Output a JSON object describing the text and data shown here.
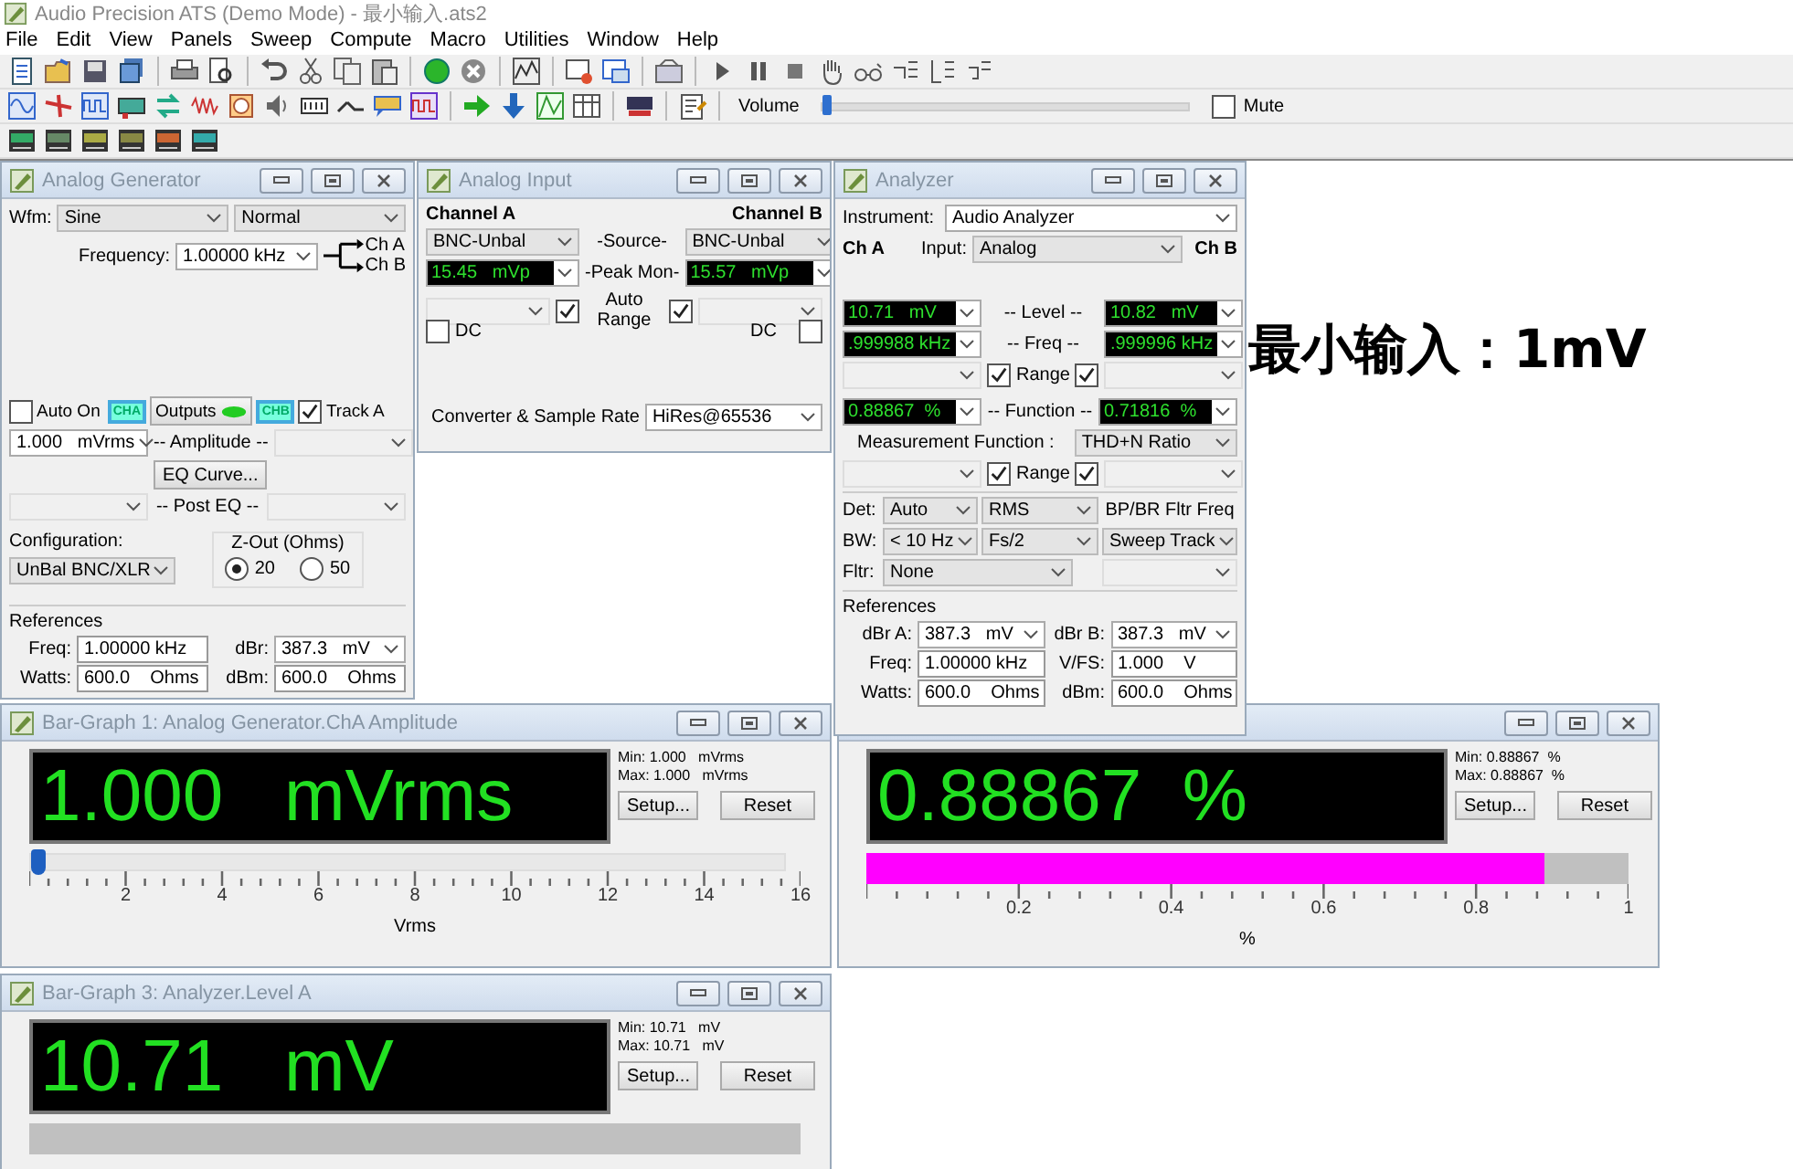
{
  "window": {
    "title": "Audio Precision ATS (Demo Mode) - 最小输入.ats2"
  },
  "menu": [
    "File",
    "Edit",
    "View",
    "Panels",
    "Sweep",
    "Compute",
    "Macro",
    "Utilities",
    "Window",
    "Help"
  ],
  "toolbar": {
    "volume_label": "Volume",
    "volume": {
      "level": 0.0
    },
    "mute": {
      "label": "Mute",
      "checked": false
    }
  },
  "generator": {
    "title": "Analog Generator",
    "wfm_label": "Wfm:",
    "waveform": "Sine",
    "mode": "Normal",
    "frequency_label": "Frequency:",
    "frequency": "1.00000 kHz",
    "route": [
      "Ch A",
      "Ch B"
    ],
    "auto_on": {
      "label": "Auto On",
      "checked": false
    },
    "cha": "CHA",
    "outputs": {
      "label": "Outputs",
      "on": true
    },
    "chb": "CHB",
    "track_a": {
      "label": "Track A",
      "checked": true
    },
    "amplitude": "1.000   mVrms",
    "amplitude_label": "-- Amplitude --",
    "eq_button": "EQ Curve...",
    "post_eq_label": "-- Post EQ --",
    "configuration_label": "Configuration:",
    "configuration": "UnBal BNC/XLR",
    "zout_label": "Z-Out (Ohms)",
    "zout": [
      {
        "label": "20",
        "selected": true
      },
      {
        "label": "50",
        "selected": false
      }
    ],
    "references_label": "References",
    "refs": [
      {
        "label": "Freq:",
        "value": "1.00000 kHz",
        "kind": "field"
      },
      {
        "label": "dBr:",
        "value": "387.3   mV",
        "kind": "combo"
      },
      {
        "label": "Watts:",
        "value": "600.0    Ohms",
        "kind": "field"
      },
      {
        "label": "dBm:",
        "value": "600.0    Ohms",
        "kind": "field"
      }
    ]
  },
  "input": {
    "title": "Analog Input",
    "channel_a": "Channel A",
    "channel_b": "Channel B",
    "source_a": "BNC-Unbal",
    "source_label": "-Source-",
    "source_b": "BNC-Unbal",
    "peak_a": "15.45   mVp",
    "peak_label": "-Peak Mon-",
    "peak_b": "15.57   mVp",
    "autorange_a": true,
    "autorange_label": "Auto Range",
    "autorange_b": true,
    "dc_a": {
      "label": "DC",
      "checked": false
    },
    "dc_b": {
      "label": "DC",
      "checked": false
    },
    "converter_label": "Converter & Sample Rate",
    "converter": "HiRes@65536"
  },
  "analyzer": {
    "title": "Analyzer",
    "instrument_label": "Instrument:",
    "instrument": "Audio Analyzer",
    "ch_a": "Ch A",
    "input_label": "Input:",
    "input": "Analog",
    "ch_b": "Ch B",
    "readings": [
      {
        "a": "10.71   mV",
        "label": "-- Level --",
        "b": "10.82   mV"
      },
      {
        "a": ".999988 kHz",
        "label": "-- Freq --",
        "b": ".999996 kHz"
      }
    ],
    "range1": {
      "label": "Range",
      "a_checked": true,
      "b_checked": true
    },
    "function": {
      "a": "0.88867  %",
      "label": "-- Function --",
      "b": "0.71816  %"
    },
    "measurement_label": "Measurement Function :",
    "measurement": "THD+N Ratio",
    "range2": {
      "label": "Range",
      "a_checked": true,
      "b_checked": true
    },
    "det_label": "Det:",
    "det": "Auto",
    "det_mode": "RMS",
    "bp_label": "BP/BR Fltr Freq",
    "bw_label": "BW:",
    "bw_low": "< 10 Hz",
    "bw_high": "Fs/2",
    "bp": "Sweep Track",
    "fltr_label": "Fltr:",
    "fltr": "None",
    "references_label": "References",
    "refs": [
      {
        "label": "dBr A:",
        "value": "387.3   mV",
        "kind": "combo"
      },
      {
        "label": "dBr B:",
        "value": "387.3   mV",
        "kind": "combo"
      },
      {
        "label": "Freq:",
        "value": "1.00000 kHz",
        "kind": "field"
      },
      {
        "label": "V/FS:",
        "value": "1.000    V",
        "kind": "field"
      },
      {
        "label": "Watts:",
        "value": "600.0    Ohms",
        "kind": "field"
      },
      {
        "label": "dBm:",
        "value": "600.0    Ohms",
        "kind": "field"
      }
    ]
  },
  "bar_graphs": [
    {
      "title": "Bar-Graph 1: Analog Generator.ChA Amplitude",
      "reading": "1.000   mVrms",
      "min": "Min: 1.000   mVrms",
      "max": "Max: 1.000   mVrms",
      "setup": "Setup...",
      "reset": "Reset",
      "kind": "slider",
      "level": 0.0,
      "ticks": [
        "2",
        "4",
        "6",
        "8",
        "10",
        "12",
        "14",
        "16"
      ],
      "unit": "Vrms"
    },
    {
      "reading": "0.88867  %",
      "min": "Min: 0.88867  %",
      "max": "Max: 0.88867  %",
      "setup": "Setup...",
      "reset": "Reset",
      "kind": "bar",
      "level": 0.88867,
      "ticks": [
        "0.2",
        "0.4",
        "0.6",
        "0.8",
        "1"
      ],
      "unit": "%"
    },
    {
      "title": "Bar-Graph 3: Analyzer.Level A",
      "reading": "10.71   mV",
      "min": "Min: 10.71   mV",
      "max": "Max: 10.71   mV",
      "setup": "Setup...",
      "reset": "Reset",
      "kind": "bar"
    }
  ],
  "annotation": "最小输入：1mV"
}
